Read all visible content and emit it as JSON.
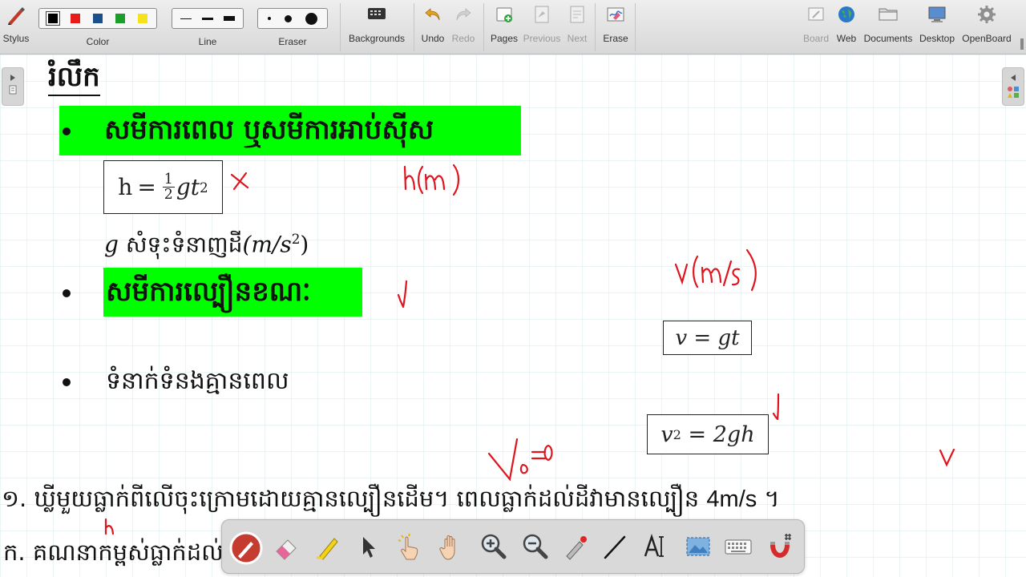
{
  "toolbar": {
    "stylus": "Stylus",
    "color_label": "Color",
    "line_label": "Line",
    "eraser_label": "Eraser",
    "backgrounds": "Backgrounds",
    "undo": "Undo",
    "redo": "Redo",
    "pages": "Pages",
    "previous": "Previous",
    "next": "Next",
    "erase": "Erase",
    "board": "Board",
    "web": "Web",
    "documents": "Documents",
    "desktop": "Desktop",
    "openboard": "OpenBoard"
  },
  "colors": {
    "palette": [
      "#000000",
      "#e81b1b",
      "#1a4f8b",
      "#1d9e2a",
      "#f5e21b"
    ],
    "highlight": "#00ff00",
    "ink": "#e0141e"
  },
  "board": {
    "title": "រំលឹក",
    "bullet1": "សមីការពេល ឬសមីការអាប់ស៊ីស",
    "formula_h_lhs": "h",
    "formula_h_eq": "=",
    "formula_h_num": "1",
    "formula_h_den": "2",
    "formula_h_rhs": "gt",
    "formula_h_exp": "2",
    "g_symbol": "g",
    "g_text": "សំទុះទំនាញដី",
    "g_unit": "(m/s",
    "g_unit_exp": "2",
    "g_unit_close": ")",
    "bullet2": "សមីការល្បឿនខណៈ",
    "bullet3": "ទំនាក់ទំនងគ្មានពេល",
    "formula_v": "v = gt",
    "formula_v2_lhs": "v",
    "formula_v2_exp": "2",
    "formula_v2_rhs": " = 2gh",
    "question1": "១. ឃ្លីមួយធ្លាក់ពីលើចុះក្រោមដោយគ្មានល្បឿនដើម។ ពេលធ្លាក់ដល់ដីវាមានល្បឿន",
    "question1_value": "4m/s",
    "question1_end": "។",
    "question1a": "ក. គណនាកម្ពស់ធ្លាក់ដល់ដី ?"
  },
  "handwriting": {
    "h_unit": "h(m)",
    "v_unit": "v(m/s)",
    "v0": "V₀=0",
    "v": "v",
    "h": "h",
    "x": "×"
  },
  "float_tools": [
    "pen-tool",
    "eraser-tool",
    "marker-tool",
    "selector-tool",
    "interact-tool",
    "hand-tool",
    "zoom-in-tool",
    "zoom-out-tool",
    "laser-pointer-tool",
    "line-tool",
    "text-tool",
    "capture-tool",
    "keyboard-tool",
    "grid-snap-tool"
  ]
}
